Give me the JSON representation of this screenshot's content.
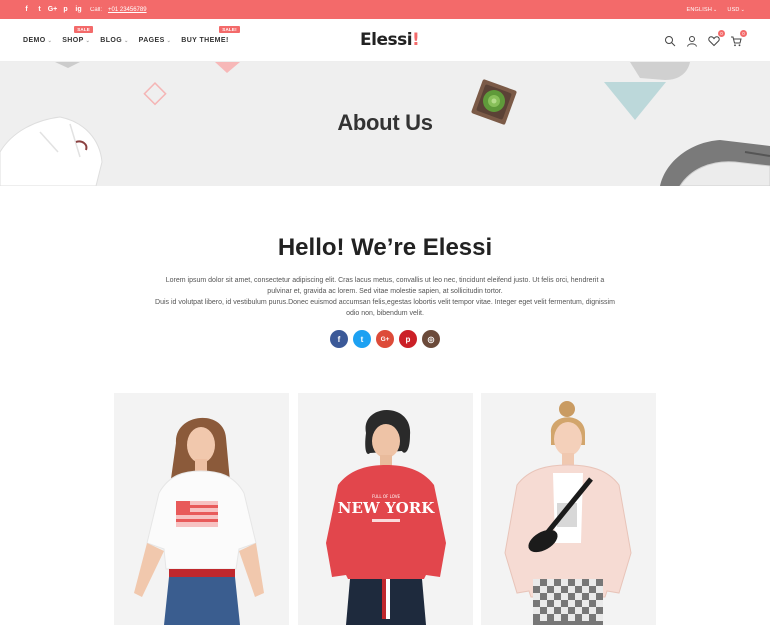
{
  "topbar": {
    "socials": [
      "f",
      "t",
      "G+",
      "p",
      "ig"
    ],
    "call_label": "Call:",
    "phone": "+01 23456789",
    "language": "ENGLISH",
    "currency": "USD"
  },
  "nav": {
    "items": [
      {
        "label": "DEMO",
        "chevron": "⌄"
      },
      {
        "label": "SHOP",
        "chevron": "⌄",
        "badge": "SALE"
      },
      {
        "label": "BLOG",
        "chevron": "⌄"
      },
      {
        "label": "PAGES",
        "chevron": "⌄"
      },
      {
        "label": "BUY THEME!",
        "badge": "SALE!"
      }
    ]
  },
  "logo": {
    "text": "Elessi",
    "mark": "!"
  },
  "header_icons": {
    "wishlist_count": "0",
    "cart_count": "0"
  },
  "banner": {
    "title": "About Us"
  },
  "intro": {
    "title": "Hello! We’re Elessi",
    "paragraph1": "Lorem ipsum dolor sit amet, consectetur adipiscing elit. Cras lacus metus, convallis ut leo nec, tincidunt eleifend justo. Ut felis orci, hendrerit a pulvinar et, gravida ac lorem. Sed vitae molestie sapien, at sollicitudin tortor.",
    "paragraph2": "Duis id volutpat libero, id vestibulum purus.Donec euismod accumsan felis,egestas lobortis velit tempor vitae. Integer eget velit fermentum, dignissim odio non, bibendum velit."
  },
  "share": [
    {
      "name": "facebook",
      "glyph": "f",
      "color": "#3b5998"
    },
    {
      "name": "twitter",
      "glyph": "t",
      "color": "#1da1f2"
    },
    {
      "name": "google-plus",
      "glyph": "G+",
      "color": "#dd4b39"
    },
    {
      "name": "pinterest",
      "glyph": "p",
      "color": "#cb2027"
    },
    {
      "name": "instagram",
      "glyph": "◎",
      "color": "#6b4a3a"
    }
  ],
  "colors": {
    "accent": "#f36a6a"
  }
}
